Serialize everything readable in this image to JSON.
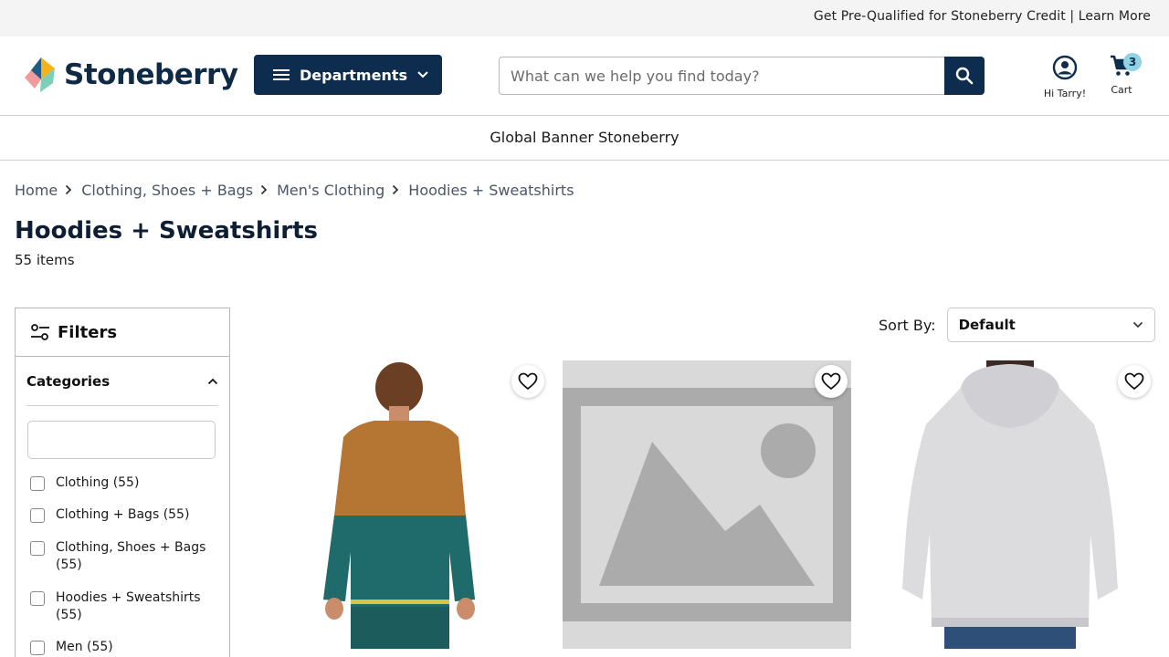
{
  "promo": {
    "text": "Get Pre-Qualified for Stoneberry Credit | Learn More"
  },
  "header": {
    "logo_text": "Stoneberry",
    "departments_label": "Departments",
    "search_placeholder": "What can we help you find today?",
    "search_value": "",
    "account_label": "Hi Tarry!",
    "cart_label": "Cart",
    "cart_count": "3",
    "brand_color": "#0e2d4e",
    "badge_color": "#8fd3e4"
  },
  "banner": {
    "text": "Global Banner Stoneberry"
  },
  "breadcrumb": [
    {
      "label": "Home"
    },
    {
      "label": "Clothing, Shoes + Bags"
    },
    {
      "label": "Men's Clothing"
    },
    {
      "label": "Hoodies + Sweatshirts"
    }
  ],
  "page": {
    "title": "Hoodies + Sweatshirts",
    "item_count": "55 items"
  },
  "filters": {
    "title": "Filters",
    "categories_label": "Categories",
    "category_search_value": "",
    "options": [
      {
        "label": "Clothing (55)"
      },
      {
        "label": "Clothing + Bags (55)"
      },
      {
        "label": "Clothing, Shoes + Bags (55)"
      },
      {
        "label": "Hoodies + Sweatshirts (55)"
      },
      {
        "label": "Men (55)"
      }
    ]
  },
  "sort": {
    "label": "Sort By:",
    "value": "Default"
  },
  "products": [
    {
      "image": "fleece-jacket-back-view",
      "wishlist_icon": "heart-icon"
    },
    {
      "image": "image-placeholder",
      "wishlist_icon": "heart-icon"
    },
    {
      "image": "gray-hoodie-back-view",
      "wishlist_icon": "heart-icon"
    }
  ]
}
